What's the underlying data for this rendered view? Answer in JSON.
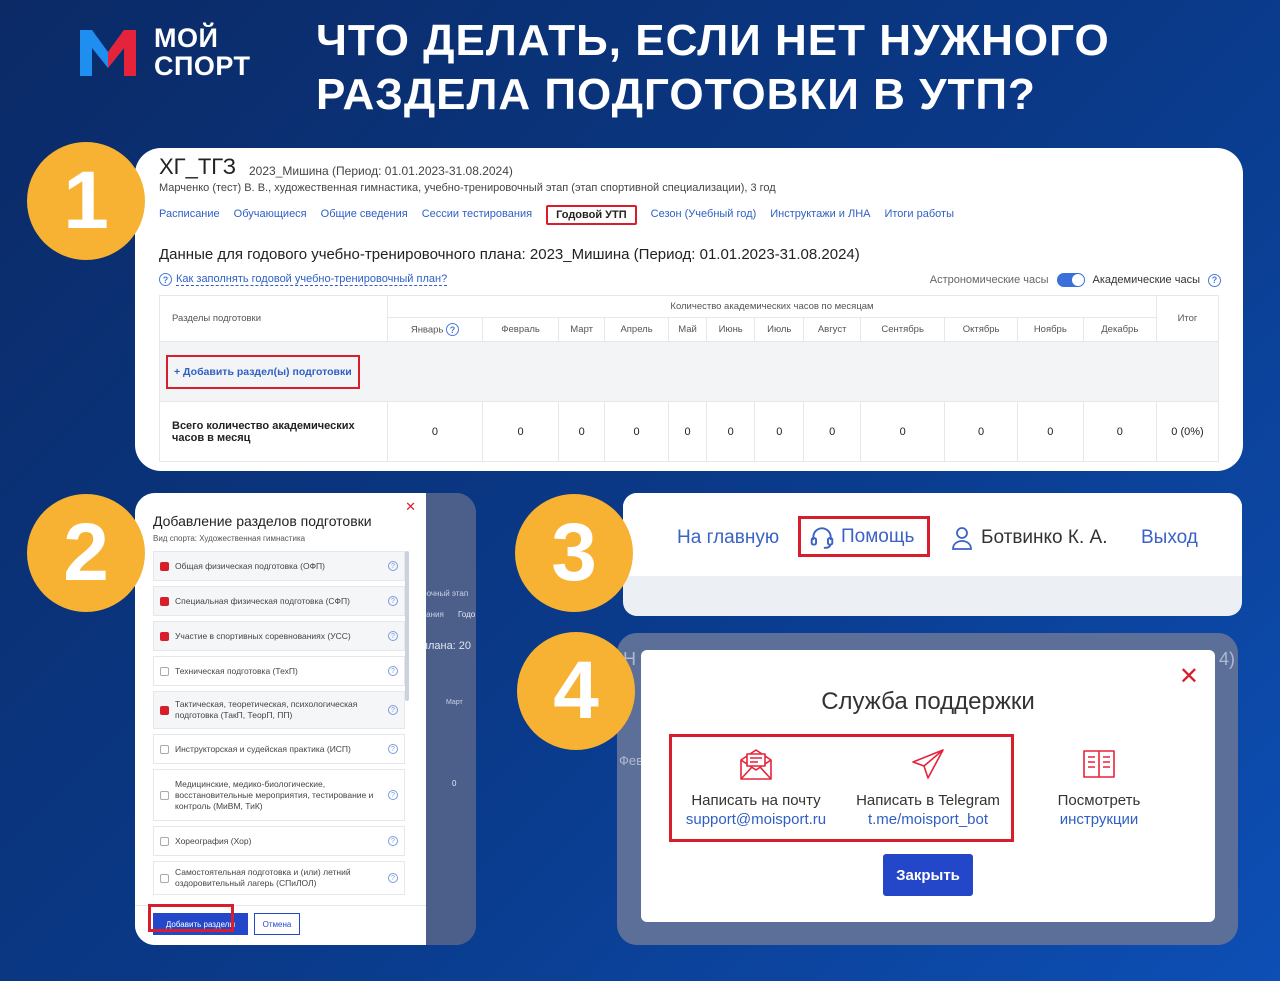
{
  "brand": {
    "line1": "МОЙ",
    "line2": "СПОРТ",
    "colors": {
      "m_blue": "#1f8ef1",
      "m_red": "#e5233b"
    }
  },
  "headline": "ЧТО ДЕЛАТЬ, ЕСЛИ НЕТ НУЖНОГО РАЗДЕЛА ПОДГОТОВКИ В УТП?",
  "steps": [
    "1",
    "2",
    "3",
    "4"
  ],
  "panel1": {
    "title": "ХГ_ТГЗ",
    "title_sub": "2023_Мишина (Период: 01.01.2023-31.08.2024)",
    "meta": "Марченко (тест) В. В., художественная гимнастика, учебно-тренировочный этап (этап спортивной специализации), 3 год",
    "tabs": [
      "Расписание",
      "Обучающиеся",
      "Общие сведения",
      "Сессии тестирования",
      "Годовой УТП",
      "Сезон (Учебный год)",
      "Инструктажи и ЛНА",
      "Итоги работы"
    ],
    "heading": "Данные для годового учебно-тренировочного плана: 2023_Мишина (Период: 01.01.2023-31.08.2024)",
    "help_link": "Как заполнять годовой учебно-тренировочный план?",
    "toggle_left": "Астрономические часы",
    "toggle_right": "Академические часы",
    "table": {
      "sections_header": "Разделы подготовки",
      "months_header": "Количество академических часов по месяцам",
      "total_header": "Итог",
      "months": [
        "Январь",
        "Февраль",
        "Март",
        "Апрель",
        "Май",
        "Июнь",
        "Июль",
        "Август",
        "Сентябрь",
        "Октябрь",
        "Ноябрь",
        "Декабрь"
      ],
      "add_button": "+ Добавить раздел(ы) подготовки",
      "total_label": "Всего количество академических часов в месяц",
      "totals": [
        "0",
        "0",
        "0",
        "0",
        "0",
        "0",
        "0",
        "0",
        "0",
        "0",
        "0",
        "0"
      ],
      "grand_total": "0 (0%)"
    }
  },
  "panel2": {
    "title": "Добавление разделов подготовки",
    "subtitle": "Вид спорта: Художественная гимнастика",
    "options": [
      {
        "label": "Общая физическая подготовка (ОФП)",
        "checked": true
      },
      {
        "label": "Специальная физическая подготовка (СФП)",
        "checked": true
      },
      {
        "label": "Участие в спортивных соревнованиях (УСС)",
        "checked": true
      },
      {
        "label": "Техническая подготовка (ТехП)",
        "checked": false
      },
      {
        "label": "Тактическая, теоретическая, психологическая подготовка (ТакП, ТеорП, ПП)",
        "checked": true
      },
      {
        "label": "Инструкторская и судейская практика (ИСП)",
        "checked": false
      },
      {
        "label": "Медицинские, медико-биологические, восстановительные мероприятия, тестирование и контроль (МиВМ, ТиК)",
        "checked": false
      },
      {
        "label": "Хореография (Хор)",
        "checked": false
      },
      {
        "label": "Самостоятельная подготовка и (или) летний оздоровительный лагерь (СПиЛОЛ)",
        "checked": false
      }
    ],
    "add_button": "Добавить разделы",
    "cancel_button": "Отмена",
    "bg_fragments": [
      "бочный этап",
      "вания",
      "Годо",
      "плана: 20",
      "Март",
      "0"
    ]
  },
  "panel3": {
    "home": "На главную",
    "help": "Помощь",
    "user": "Ботвинко К. А.",
    "logout": "Выход"
  },
  "panel4": {
    "title": "Служба поддержки",
    "mail_label": "Написать на почту",
    "mail_link": "support@moisport.ru",
    "tg_label": "Написать в Telegram",
    "tg_link": "t.me/moisport_bot",
    "docs_label": "Посмотреть",
    "docs_link": "инструкции",
    "close_button": "Закрыть",
    "bg_fragments": [
      "Н",
      "4)",
      "Фев"
    ]
  }
}
